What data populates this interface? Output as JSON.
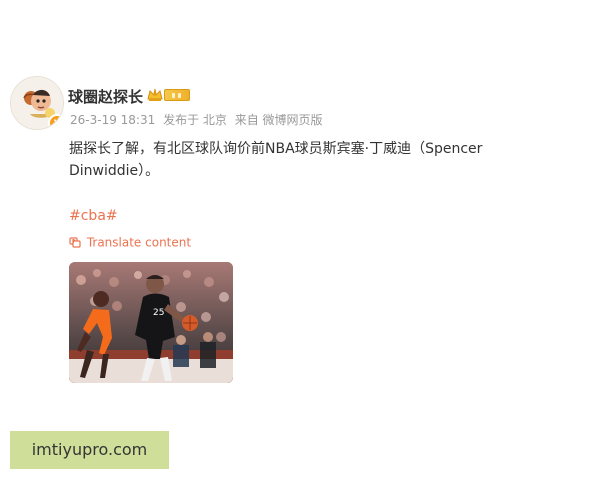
{
  "post": {
    "author": {
      "name": "球圈赵探长",
      "verified_badge_label": "v",
      "level_badge": "gold-level-badge"
    },
    "meta": {
      "date": "26-3-19 18:31",
      "location": "发布于 北京",
      "source": "来自 微博网页版"
    },
    "body": "据探长了解，有北区球队询价前NBA球员斯宾塞·丁威迪（Spencer Dinwiddie）。",
    "topic": "#cba#",
    "translate": {
      "label": "Translate content"
    },
    "image": {
      "jersey_number": "25"
    }
  },
  "watermark": {
    "text": "imtiyupro.com"
  },
  "colors": {
    "accent": "#eb7350",
    "text": "#333333",
    "meta": "#999999",
    "watermark_bg": "#cfdf9a",
    "badge": "#f79d1a"
  },
  "icons": {
    "crown": "crown-icon",
    "translate": "translate-icon",
    "verified": "verified-icon"
  }
}
